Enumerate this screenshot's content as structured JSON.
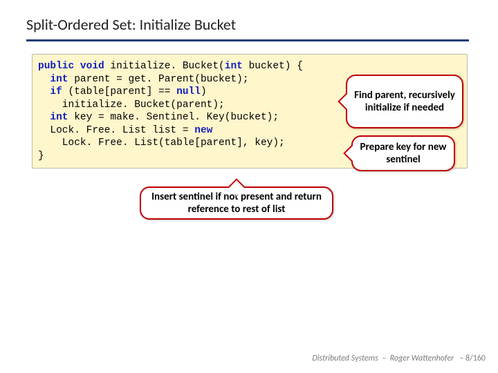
{
  "title": "Split-Ordered Set: Initialize Bucket",
  "code": {
    "l1a": "public",
    "l1b": "void",
    "l1c": " initialize. Bucket(",
    "l1d": "int",
    "l1e": " bucket) {",
    "l2a": "  ",
    "l2b": "int",
    "l2c": " parent = get. Parent(bucket);",
    "l3a": "  ",
    "l3b": "if",
    "l3c": " (table[parent] == ",
    "l3d": "null",
    "l3e": ")",
    "l4": "    initialize. Bucket(parent);",
    "l5a": "  ",
    "l5b": "int",
    "l5c": " key = make. Sentinel. Key(bucket);",
    "l6a": "  Lock. Free. List list = ",
    "l6b": "new",
    "l7": "    Lock. Free. List(table[parent], key);",
    "l8": "}"
  },
  "callouts": {
    "c1": "Find parent, recursively initialize if needed",
    "c2": "Prepare key for new sentinel",
    "c3": "Insert sentinel if not present and return reference to rest of list"
  },
  "footer": {
    "course": "Distributed Systems",
    "sep": "–",
    "author": "Roger Wattenhofer",
    "page": "– 8/160"
  }
}
